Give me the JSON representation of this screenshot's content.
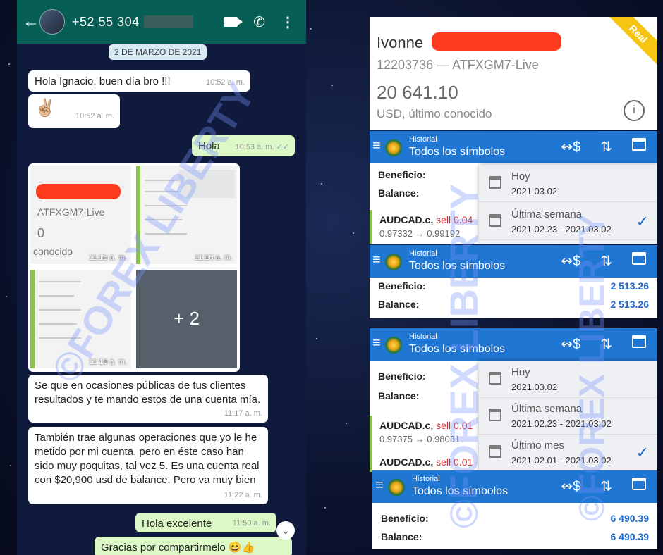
{
  "whatsapp": {
    "contact": "+52 55 304",
    "date_chip": "2 DE MARZO DE 2021",
    "messages": [
      {
        "text": "Hola Ignacio, buen día bro !!!",
        "time": "10:52 a. m."
      },
      {
        "text": "✌🏼",
        "time": "10:52 a. m."
      },
      {
        "text": "Hola",
        "time": "10:53 a. m.",
        "ticks": "✓✓"
      },
      {
        "text": "Se que en ocasiones públicas de tus clientes resultados y te mando estos de una cuenta mía.",
        "time": "11:17 a. m."
      },
      {
        "text": "También trae algunas operaciones que yo le he metido por mi cuenta, pero en éste caso han sido muy poquitas, tal vez 5. Es una cuenta real con $20,900 usd de balance. Pero va muy bien",
        "time": "11:22 a. m."
      },
      {
        "text": "Hola excelente",
        "time": "11:50 a. m."
      },
      {
        "text": "Gracias por compartirmelo 😄👍",
        "time": ""
      }
    ],
    "gallery": {
      "thumb1_account": "ATFXGM7-Live",
      "thumb1_value": "0",
      "thumb1_caption": "conocido",
      "time1": "11:16 a. m.",
      "time2": "11:16 a. m.",
      "time3": "11:16 a. m.",
      "more": "+ 2"
    }
  },
  "account": {
    "name": "Ivonne",
    "id": "12203736 — ATFXGM7-Live",
    "balance": "20 641.10",
    "currency": "USD, último conocido",
    "badge": "Real"
  },
  "history": {
    "sub": "Historial",
    "title": "Todos los símbolos",
    "beneficio_label": "Beneficio:",
    "balance_label": "Balance:",
    "panel2_beneficio": "2 513.26",
    "panel2_balance": "2 513.26",
    "panel4_beneficio": "6 490.39",
    "panel4_balance": "6 490.39",
    "hoy": "Hoy",
    "hoy_date": "2021.03.02",
    "semana": "Última semana",
    "semana_range": "2021.02.23 - 2021.03.02",
    "mes": "Último mes",
    "mes_range": "2021.02.01 - 2021.03.02",
    "trade1_sym": "AUDCAD.c,",
    "trade1_side": "sell 0.04",
    "trade1_px": "0.97332 → 0.99192",
    "trade2_sym": "AUDCAD.c,",
    "trade2_side": "sell 0.01",
    "trade2_px": "0.97375 → 0.98031",
    "trade3_sym": "AUDCAD.c,",
    "trade3_side": "sell 0.01"
  },
  "watermark": "©FOREX LIBERTY"
}
